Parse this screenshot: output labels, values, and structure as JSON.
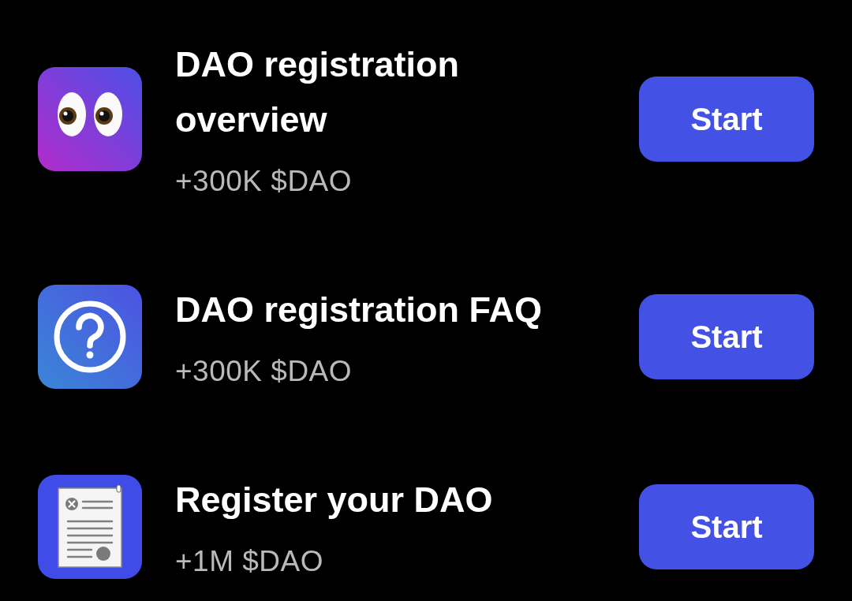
{
  "tasks": [
    {
      "kind": "eyes",
      "title": "DAO registration overview",
      "reward": "+300K $DAO",
      "button": "Start"
    },
    {
      "kind": "question",
      "title": "DAO registration FAQ",
      "reward": "+300K $DAO",
      "button": "Start"
    },
    {
      "kind": "document",
      "title": "Register your DAO",
      "reward": "+1M $DAO",
      "button": "Start"
    }
  ]
}
